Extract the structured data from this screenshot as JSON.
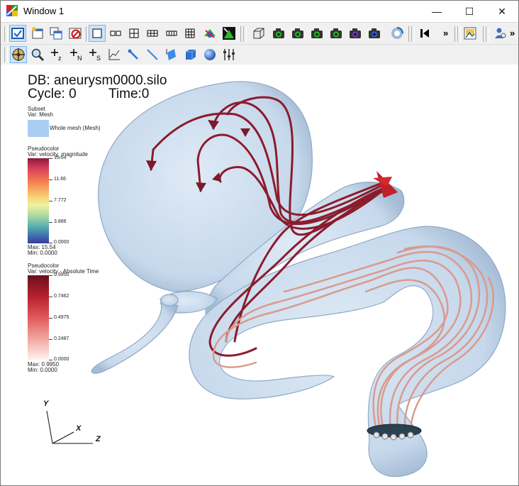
{
  "window": {
    "title": "Window 1",
    "minimize_glyph": "—",
    "maximize_glyph": "☐",
    "close_glyph": "✕"
  },
  "toolbar": {
    "overflow_1": "»",
    "overflow_2": "»",
    "icons_row1": [
      "active-window-icon",
      "new-window-icon",
      "clone-window-icon",
      "delete-window-icon",
      "layout-1x1-icon",
      "layout-1x2-icon",
      "layout-2x2-icon",
      "layout-2x3-icon",
      "layout-3x2-icon",
      "layout-3x3-icon",
      "lock-view-icon",
      "lock-time-icon",
      "perspective-box-icon",
      "camera-icon",
      "camera-icon",
      "camera-icon",
      "camera-icon",
      "camera-icon",
      "camera-icon",
      "camera-icon",
      "spin-icon",
      "play-back-icon",
      "print-icon",
      "person-icon"
    ],
    "icons_row2": [
      "navigate-icon",
      "zoom-icon",
      "plus-z-icon",
      "plus-n-icon",
      "plus-s-icon",
      "lineout-icon",
      "pick-icon",
      "line-tool-icon",
      "plane-tool-icon",
      "box-tool-icon",
      "sphere-tool-icon",
      "slider-tool-icon"
    ]
  },
  "annotation": {
    "db": "DB: aneurysm0000.silo",
    "cycle": "Cycle: 0",
    "time": "Time:0"
  },
  "legend_subset": {
    "title": "Subset",
    "var": "Var: Mesh",
    "entry": "Whole mesh (Mesh)",
    "swatch_color": "#a9cdf2"
  },
  "legend_velocity": {
    "title": "Pseudocolor",
    "var": "Var: velocity_magnitude",
    "ticks": [
      "15.54",
      "11.66",
      "7.772",
      "3.886",
      "0.0000"
    ],
    "max": "Max: 15.54",
    "min": "Min: 0.0000"
  },
  "legend_time": {
    "title": "Pseudocolor",
    "var": "Var: velocity - Absolute Time",
    "ticks": [
      "0.9950",
      "0.7462",
      "0.4975",
      "0.2487",
      "0.0000"
    ],
    "max": "Max: 0.9950",
    "min": "Min: 0.0000"
  },
  "triad": {
    "x": "X",
    "y": "Y",
    "z": "Z"
  },
  "colors": {
    "mesh": "#b9d3ea",
    "streamline_dark": "#8b1c2c",
    "streamline_light": "#e8c6bc",
    "toolbar_bg": "#f0f0f0"
  }
}
